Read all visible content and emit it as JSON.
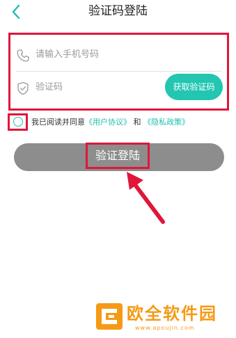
{
  "header": {
    "title": "验证码登陆",
    "back_icon": "chevron-left-icon"
  },
  "form": {
    "phone_placeholder": "请输入手机号码",
    "phone_icon": "phone-icon",
    "code_placeholder": "验证码",
    "code_icon": "shield-check-icon",
    "get_code_label": "获取验证码"
  },
  "agreement": {
    "prefix": "我已阅读并同意",
    "user_agreement": "《用户协议》",
    "conjunction": "和",
    "privacy_policy": "《隐私政策》",
    "checked": false
  },
  "login_button": {
    "label": "验证登陆"
  },
  "watermark": {
    "text": "欧全软件园",
    "url": "www.apoujin.com"
  },
  "colors": {
    "accent": "#22c6b1",
    "highlight": "#e0163b",
    "button_disabled": "#8d8d8d",
    "watermark": "#f59a16"
  }
}
